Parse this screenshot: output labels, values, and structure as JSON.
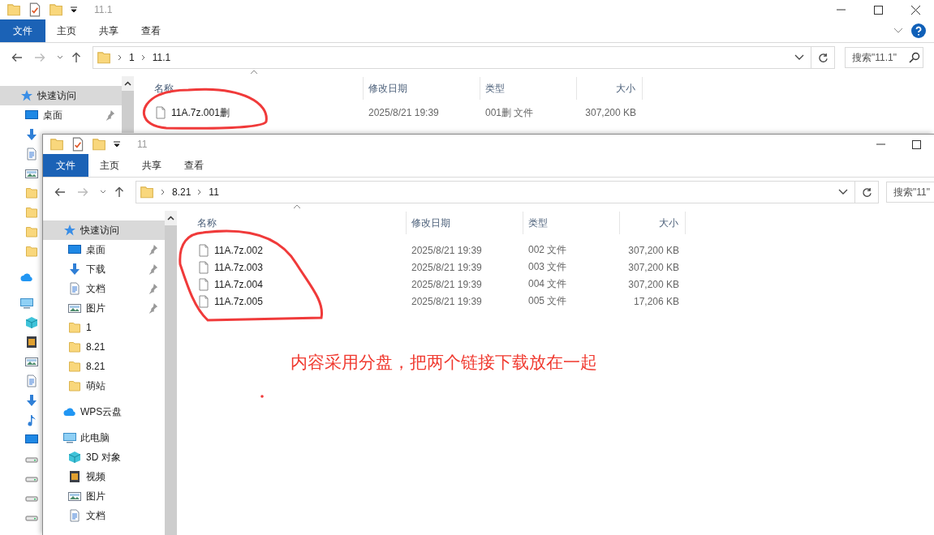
{
  "windows": [
    {
      "title": "11.1",
      "ribbon_tabs": [
        {
          "label": "文件",
          "kind": "file-menu"
        },
        {
          "label": "主页",
          "kind": "tab"
        },
        {
          "label": "共享",
          "kind": "tab"
        },
        {
          "label": "查看",
          "kind": "tab"
        }
      ],
      "address": {
        "path": [
          "1",
          "11.1"
        ]
      },
      "search": {
        "placeholder": "搜索\"11.1\""
      },
      "sidebar": {
        "items": [
          {
            "kind": "star",
            "label": "快速访问",
            "selected": true,
            "children": [
              {
                "kind": "desktop",
                "label": "桌面",
                "pinned": true
              },
              {
                "kind": "download"
              },
              {
                "kind": "document"
              },
              {
                "kind": "picture"
              },
              {
                "kind": "folder"
              },
              {
                "kind": "folder"
              },
              {
                "kind": "folder"
              },
              {
                "kind": "folder"
              }
            ]
          },
          {
            "kind": "cloud"
          },
          {
            "kind": "pc",
            "children": [
              {
                "kind": "cube"
              },
              {
                "kind": "video"
              },
              {
                "kind": "picture"
              },
              {
                "kind": "document"
              },
              {
                "kind": "download"
              },
              {
                "kind": "music"
              },
              {
                "kind": "desktop"
              },
              {
                "kind": "drive"
              },
              {
                "kind": "drive"
              },
              {
                "kind": "drive"
              },
              {
                "kind": "drive"
              }
            ]
          }
        ]
      },
      "columns": [
        "名称",
        "修改日期",
        "类型",
        "大小"
      ],
      "rows": [
        {
          "name": "11A.7z.001删",
          "modified": "2025/8/21 19:39",
          "type": "001删 文件",
          "size": "307,200 KB"
        }
      ]
    },
    {
      "title": "11",
      "ribbon_tabs": [
        {
          "label": "文件",
          "kind": "file-menu"
        },
        {
          "label": "主页",
          "kind": "tab"
        },
        {
          "label": "共享",
          "kind": "tab"
        },
        {
          "label": "查看",
          "kind": "tab"
        }
      ],
      "address": {
        "path": [
          "8.21",
          "11"
        ]
      },
      "search": {
        "placeholder": "搜索\"11\""
      },
      "sidebar": {
        "items": [
          {
            "kind": "star",
            "label": "快速访问",
            "selected": true,
            "children": [
              {
                "kind": "desktop",
                "label": "桌面",
                "pinned": true
              },
              {
                "kind": "download",
                "label": "下载",
                "pinned": true
              },
              {
                "kind": "document",
                "label": "文档",
                "pinned": true
              },
              {
                "kind": "picture",
                "label": "图片",
                "pinned": true
              },
              {
                "kind": "folder",
                "label": "1",
                "pinned": false
              },
              {
                "kind": "folder",
                "label": "8.21",
                "pinned": false
              },
              {
                "kind": "folder",
                "label": "8.21",
                "pinned": false
              },
              {
                "kind": "folder",
                "label": "萌站",
                "pinned": false
              }
            ]
          },
          {
            "kind": "cloud",
            "label": "WPS云盘",
            "selected": false
          },
          {
            "kind": "pc",
            "label": "此电脑",
            "selected": false,
            "children": [
              {
                "kind": "cube",
                "label": "3D 对象"
              },
              {
                "kind": "video",
                "label": "视频"
              },
              {
                "kind": "picture",
                "label": "图片"
              },
              {
                "kind": "document",
                "label": "文档"
              }
            ]
          }
        ]
      },
      "columns": [
        "名称",
        "修改日期",
        "类型",
        "大小"
      ],
      "rows": [
        {
          "name": "11A.7z.002",
          "modified": "2025/8/21 19:39",
          "type": "002 文件",
          "size": "307,200 KB"
        },
        {
          "name": "11A.7z.003",
          "modified": "2025/8/21 19:39",
          "type": "003 文件",
          "size": "307,200 KB"
        },
        {
          "name": "11A.7z.004",
          "modified": "2025/8/21 19:39",
          "type": "004 文件",
          "size": "307,200 KB"
        },
        {
          "name": "11A.7z.005",
          "modified": "2025/8/21 19:39",
          "type": "005 文件",
          "size": "17,206 KB"
        }
      ]
    }
  ],
  "annotation": {
    "text": "内容采用分盘，把两个链接下载放在一起"
  }
}
